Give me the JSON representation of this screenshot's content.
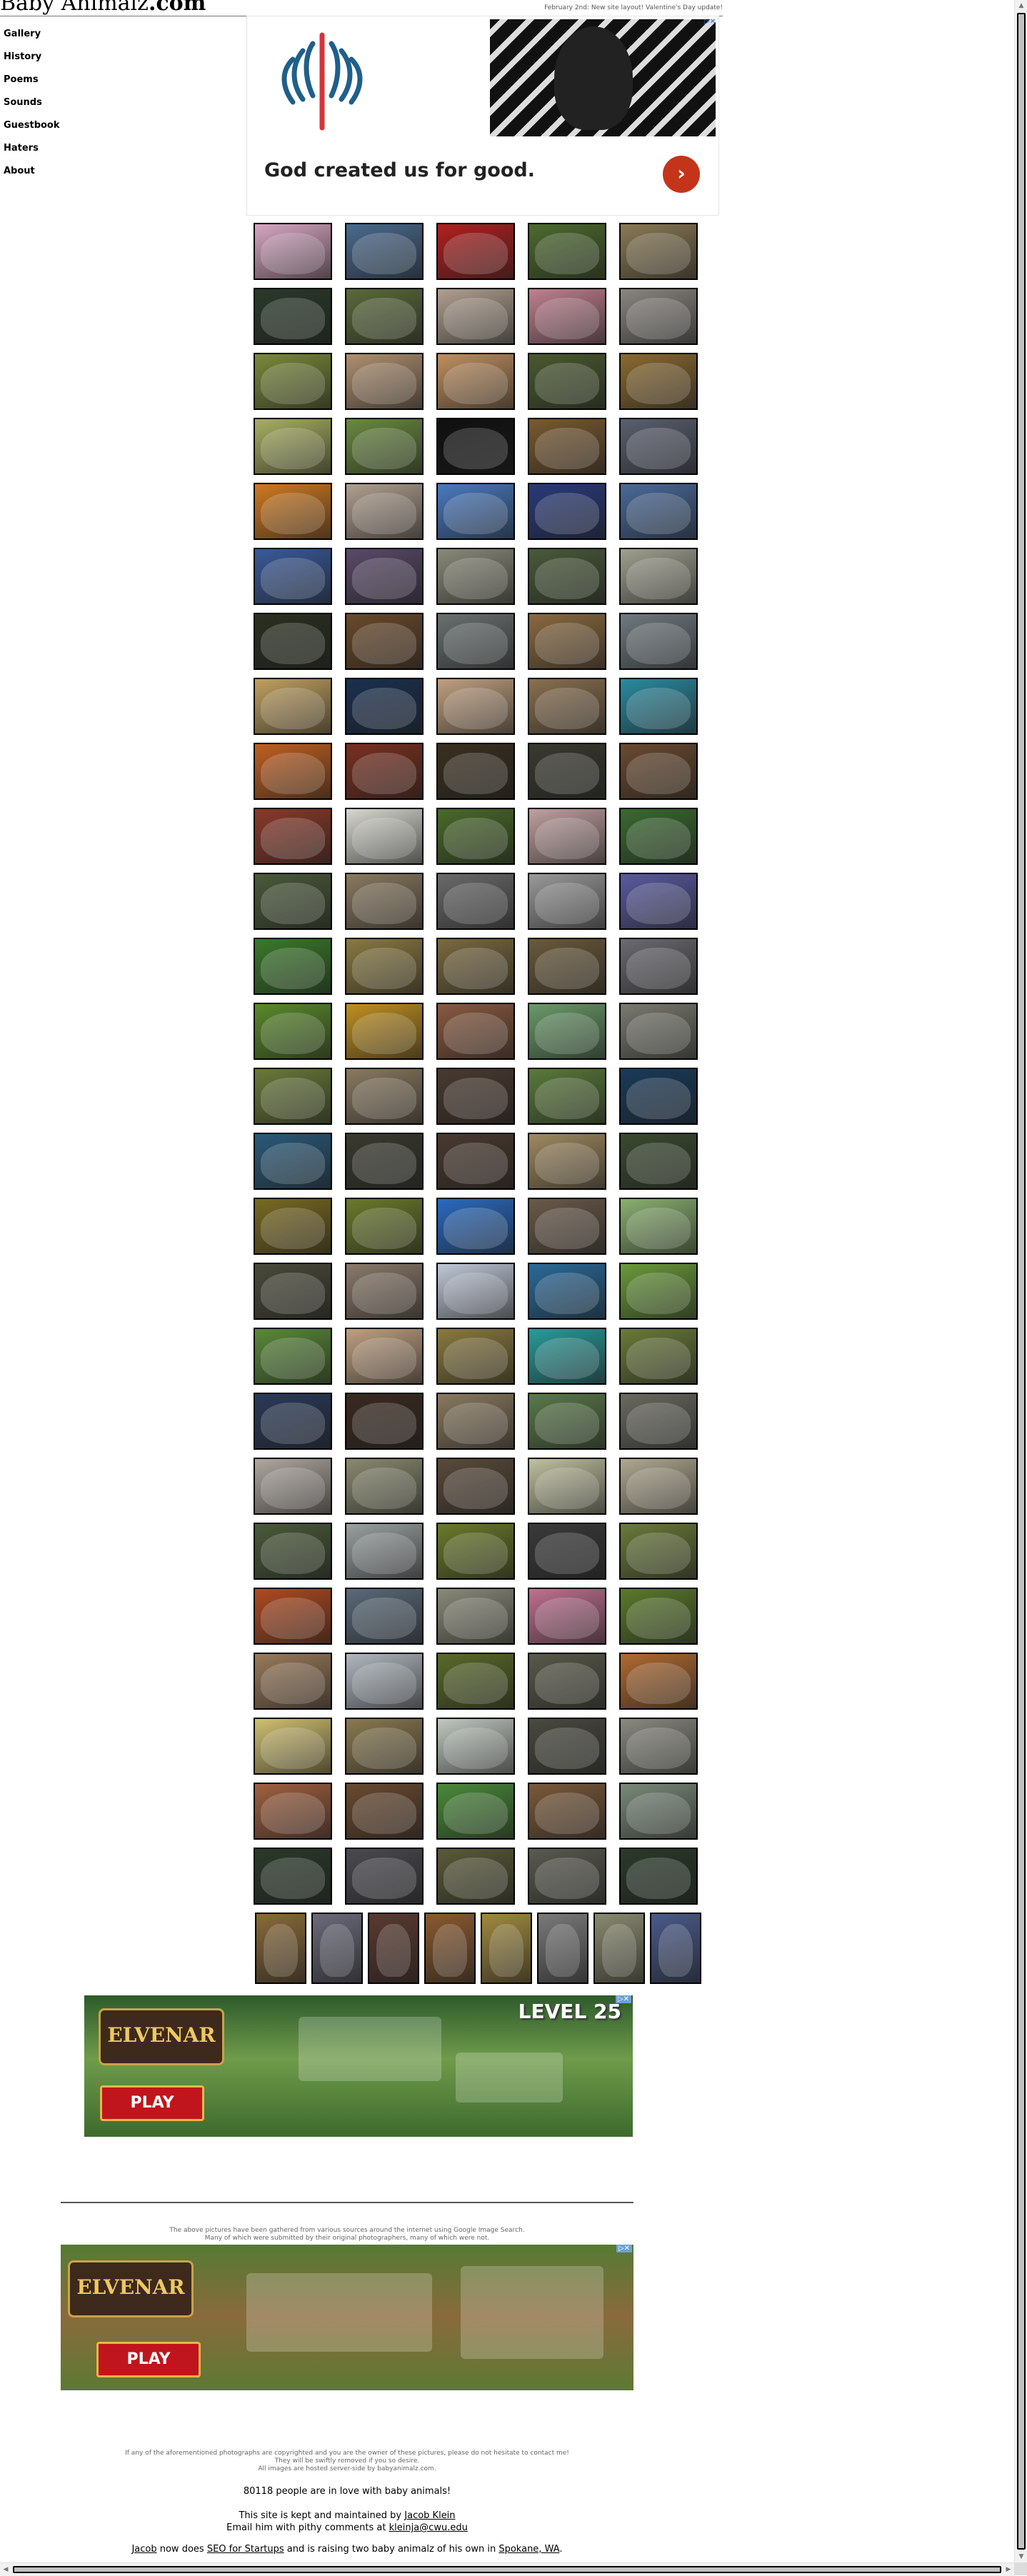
{
  "site": {
    "title_light": "Baby Animalz",
    "title_bold": ".com"
  },
  "header": {
    "update_note": "February 2nd:  New site layout!   Valentine's Day update!"
  },
  "sidebar": {
    "items": [
      {
        "label": "Gallery"
      },
      {
        "label": "History"
      },
      {
        "label": "Poems"
      },
      {
        "label": "Sounds"
      },
      {
        "label": "Guestbook"
      },
      {
        "label": "Haters"
      },
      {
        "label": "About"
      }
    ]
  },
  "top_ad": {
    "headline": "God created us for good.",
    "arrow": "›",
    "adchoice": "▷✕"
  },
  "game_ad_1": {
    "brand": "ELVENAR",
    "cta": "PLAY",
    "badge": "LEVEL 25",
    "close": "▷✕"
  },
  "game_ad_2": {
    "brand": "ELVENAR",
    "cta": "PLAY",
    "close": "▷✕"
  },
  "credits_note": {
    "line1": "The above pictures have been gathered from various sources around the internet using Google Image Search.",
    "line2": "Many of which were submitted by their original photographers, many of which were not."
  },
  "footer": {
    "copyright_1": "If any of the aforementioned photographs are copyrighted and you are the owner of these pictures, please do not hesitate to contact me!",
    "copyright_2": "They will be swiftly removed if you so desire.",
    "copyright_3": "All images are hosted server-side by babyanimalz.com.",
    "visitor_count": "80118",
    "visitor_text": " people are in love with baby animals!",
    "kept_text": "This site is kept and maintained by ",
    "author_link": "Jacob Klein",
    "email_text": "Email him with pithy comments at ",
    "email_link": "kleinja@cwu.edu",
    "seo_name_link": "Jacob",
    "seo_text_1": " now does ",
    "seo_link": "SEO for Startups",
    "seo_text_2": " and is raising two baby animalz of his own in ",
    "city_link": "Spokane, WA",
    "seo_text_3": "."
  },
  "gallery": {
    "row_colors": [
      [
        "#d8a7c3",
        "#4a6a8f",
        "#b02020",
        "#4d6b2e",
        "#8a7a55"
      ],
      [
        "#2a3a2a",
        "#5a6a3a",
        "#b0a090",
        "#c08090",
        "#8a8680"
      ],
      [
        "#7a8a3a",
        "#b09070",
        "#c09060",
        "#4a5a30",
        "#8a6a30"
      ],
      [
        "#a8b060",
        "#6a8a40",
        "#101010",
        "#7a5a30",
        "#5a6070"
      ],
      [
        "#d07a20",
        "#b0a090",
        "#4a7ac0",
        "#2a3a7a",
        "#4a6a9a"
      ],
      [
        "#3a5a9a",
        "#5a4a6a",
        "#8a8a7a",
        "#4a5a3a",
        "#a0a090"
      ],
      [
        "#2a3020",
        "#6a4a2a",
        "#6a7070",
        "#8a6a40",
        "#707a80"
      ],
      [
        "#c0a060",
        "#1a3050",
        "#c0a080",
        "#8a7050",
        "#2a8aa0"
      ],
      [
        "#c06020",
        "#7a3020",
        "#3a3020",
        "#3a3a30",
        "#6a4a30"
      ],
      [
        "#8a3a2a",
        "#d8d8d0",
        "#4a6a2a",
        "#c0a0a0",
        "#3a6a30"
      ],
      [
        "#4a5a3a",
        "#8a7a60",
        "#6a6a6a",
        "#9a9a9a",
        "#5a5aa0"
      ],
      [
        "#3a7a2a",
        "#8a7a40",
        "#7a6a40",
        "#6a5a3a",
        "#6a6a70"
      ],
      [
        "#5a8a2a",
        "#c09020",
        "#8a5a40",
        "#6a9a6a",
        "#7a7a70"
      ],
      [
        "#6a7a3a",
        "#8a7a60",
        "#4a3a30",
        "#5a7a3a",
        "#1a3a5a"
      ],
      [
        "#2a5a7a",
        "#3a3a30",
        "#4a3a30",
        "#a08a60",
        "#3a4a30"
      ],
      [
        "#7a6a20",
        "#6a7a2a",
        "#2a6ac0",
        "#6a5a4a",
        "#8ab070"
      ],
      [
        "#4a4a3a",
        "#8a7a6a",
        "#c0c8d8",
        "#2a6a9a",
        "#6a9a3a"
      ],
      [
        "#5a8a3a",
        "#c0a080",
        "#8a7a40",
        "#2a9a9a",
        "#6a7a3a"
      ],
      [
        "#2a3a5a",
        "#3a2a20",
        "#8a7a60",
        "#5a7a4a",
        "#6a6a60"
      ],
      [
        "#b0a8a0",
        "#8a8a70",
        "#5a4a3a",
        "#c0c0a0",
        "#b0a890"
      ],
      [
        "#4a5a3a",
        "#9aa0a0",
        "#6a7a2a",
        "#3a3a3a",
        "#6a7a3a"
      ],
      [
        "#b04a20",
        "#5a6a7a",
        "#8a8a7a",
        "#c07090",
        "#5a7a2a"
      ],
      [
        "#9a7a5a",
        "#b0b8c0",
        "#5a6a2a",
        "#5a5a4a",
        "#b06a30"
      ],
      [
        "#d0c070",
        "#8a7a50",
        "#c0c8c0",
        "#4a4a40",
        "#8a8a80"
      ],
      [
        "#a06040",
        "#6a4a30",
        "#4a8a3a",
        "#7a5a3a",
        "#7a8a7a"
      ],
      [
        "#2a3a2a",
        "#4a4a50",
        "#5a5a3a",
        "#5a5a50",
        "#2a3a2a"
      ]
    ],
    "last_row_colors": [
      "#8a6a3a",
      "#6a6a7a",
      "#5a3a30",
      "#8a5a30",
      "#a08a40",
      "#7a7a7a",
      "#8a8a70",
      "#4a5a8a"
    ]
  }
}
